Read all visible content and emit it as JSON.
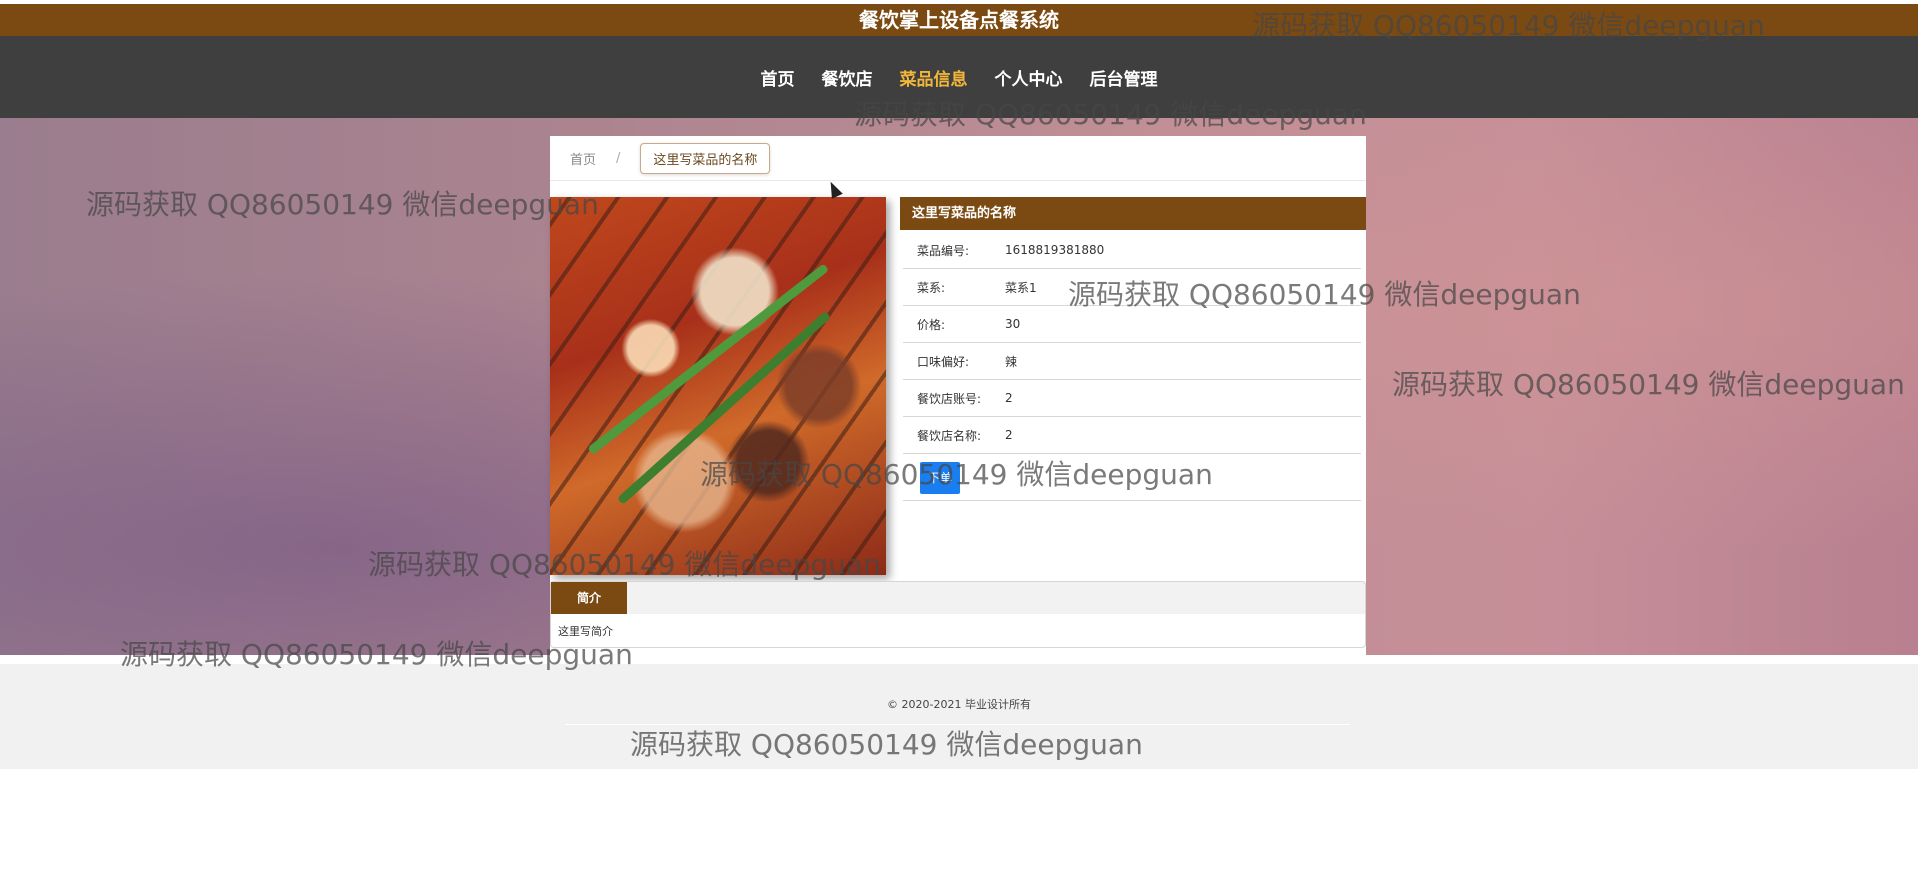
{
  "header": {
    "title": "餐饮掌上设备点餐系统"
  },
  "nav": {
    "items": [
      {
        "label": "首页"
      },
      {
        "label": "餐饮店"
      },
      {
        "label": "菜品信息"
      },
      {
        "label": "个人中心"
      },
      {
        "label": "后台管理"
      }
    ],
    "active_index": 2
  },
  "breadcrumb": {
    "home": "首页",
    "separator": "/",
    "current": "这里写菜品的名称"
  },
  "dish": {
    "title": "这里写菜品的名称",
    "fields": [
      {
        "label": "菜品编号:",
        "value": "1618819381880"
      },
      {
        "label": "菜系:",
        "value": "菜系1"
      },
      {
        "label": "价格:",
        "value": "30"
      },
      {
        "label": "口味偏好:",
        "value": "辣"
      },
      {
        "label": "餐饮店账号:",
        "value": "2"
      },
      {
        "label": "餐饮店名称:",
        "value": "2"
      }
    ],
    "order_button": "下单"
  },
  "tabs": {
    "active_label": "简介",
    "content": "这里写简介"
  },
  "footer": {
    "copyright": "© 2020-2021 毕业设计所有"
  },
  "watermark": {
    "text": "源码获取 QQ86050149 微信deepguan"
  },
  "colors": {
    "brand": "#7b4a12",
    "nav_bg": "#3f3f3f",
    "nav_active": "#f0b73a",
    "button": "#1a7ef0"
  }
}
